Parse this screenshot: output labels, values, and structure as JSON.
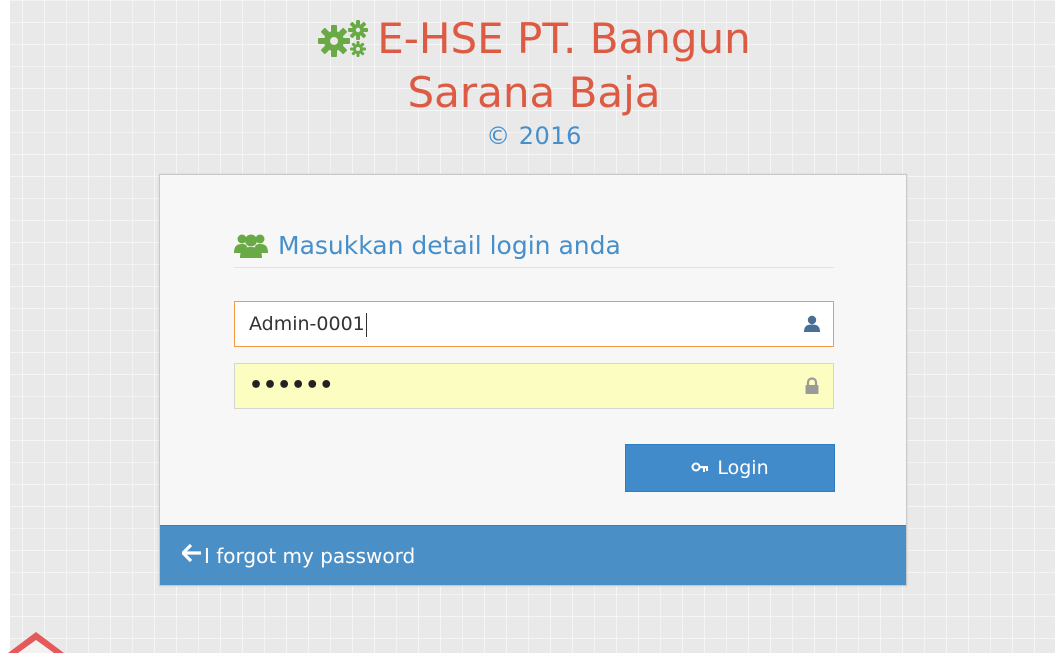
{
  "header": {
    "title_line1": "E-HSE PT. Bangun",
    "title_line2": "Sarana Baja",
    "copyright": "© 2016"
  },
  "login_box": {
    "heading": "Masukkan detail login anda",
    "username_value": "Admin-0001",
    "password_value": "••••••",
    "login_label": "Login",
    "forgot_label": "I forgot my password"
  },
  "icons": {
    "title": "gears-icon",
    "heading": "users-icon",
    "username": "user-icon",
    "password": "lock-icon",
    "login": "key-icon",
    "forgot": "arrow-left-icon"
  },
  "colors": {
    "title": "#dd5a43",
    "gears": "#69aa46",
    "accent_blue": "#478fca",
    "button_blue": "#428bca",
    "toolbar_blue": "#4b8fc7",
    "focus_border": "#f59942",
    "autofill_yellow": "#fbfdc1"
  }
}
